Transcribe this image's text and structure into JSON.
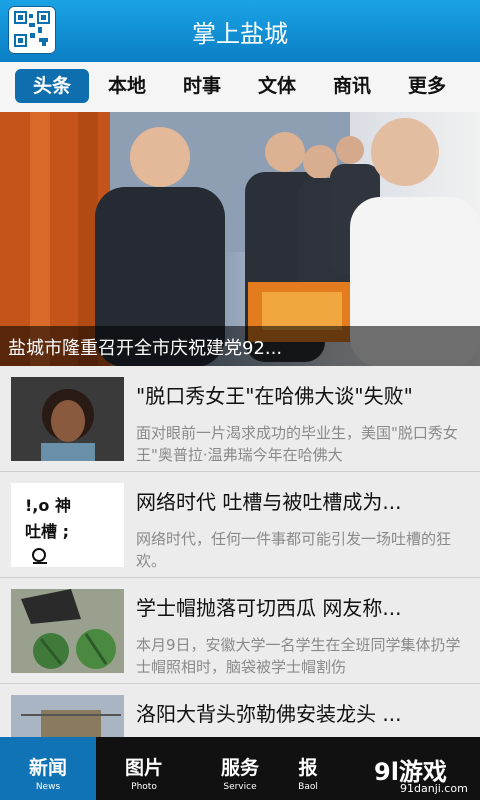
{
  "header": {
    "title": "掌上盐城",
    "qr_icon": "qr-code-icon"
  },
  "tabs": [
    {
      "label": "头条",
      "active": true
    },
    {
      "label": "本地"
    },
    {
      "label": "时事"
    },
    {
      "label": "文体"
    },
    {
      "label": "商讯"
    },
    {
      "label": "更多"
    }
  ],
  "banner": {
    "caption": "盐城市隆重召开全市庆祝建党92...",
    "dots": 5,
    "active_dot": 0
  },
  "news": [
    {
      "title": "\"脱口秀女王\"在哈佛大谈\"失败\"",
      "summary": "面对眼前一片渴求成功的毕业生，美国\"脱口秀女王\"奥普拉·温弗瑞今年在哈佛大"
    },
    {
      "title": "网络时代 吐槽与被吐槽成为...",
      "summary": "网络时代，任何一件事都可能引发一场吐槽的狂欢。",
      "thumb_text": "!,o 神吐槽 ;"
    },
    {
      "title": "学士帽抛落可切西瓜 网友称...",
      "summary": "本月9日，安徽大学一名学生在全班同学集体扔学士帽照相时，脑袋被学士帽割伤"
    },
    {
      "title": "洛阳大背头弥勒佛安装龙头 ...",
      "summary": ""
    }
  ],
  "bottom_nav": [
    {
      "cn": "新闻",
      "en": "News",
      "active": true
    },
    {
      "cn": "图片",
      "en": "Photo"
    },
    {
      "cn": "服务",
      "en": "Service"
    },
    {
      "cn": "报",
      "en": "Baol"
    }
  ],
  "watermark": {
    "logo": "9l游戏",
    "site": "91danji.com"
  }
}
